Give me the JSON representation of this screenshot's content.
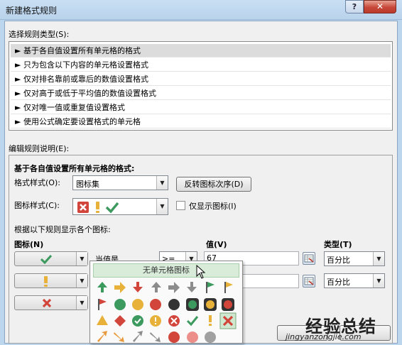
{
  "window": {
    "title": "新建格式规则",
    "help_label": "?",
    "close_label": "✕"
  },
  "rule_type": {
    "label": "选择规则类型(S):",
    "items": [
      "► 基于各自值设置所有单元格的格式",
      "► 只为包含以下内容的单元格设置格式",
      "► 仅对排名靠前或靠后的数值设置格式",
      "► 仅对高于或低于平均值的数值设置格式",
      "► 仅对唯一值或重复值设置格式",
      "► 使用公式确定要设置格式的单元格"
    ],
    "selected_index": 0
  },
  "edit": {
    "label": "编辑规则说明(E):",
    "heading": "基于各自值设置所有单元格的格式:",
    "format_style_label": "格式样式(O):",
    "format_style_value": "图标集",
    "reverse_button": "反转图标次序(D)",
    "icon_style_label": "图标样式(C):",
    "icon_style_icons": [
      "red-x-icon",
      "yellow-exclamation-icon",
      "green-check-icon"
    ],
    "show_icon_only_label": "仅显示图标(I)",
    "show_icon_only_checked": false,
    "rules_caption": "根据以下规则显示各个图标:",
    "col_icon": "图标(N)",
    "col_value": "值(V)",
    "col_type": "类型(T)",
    "rows": [
      {
        "icon": "green-check-icon",
        "cond_text": "当值是",
        "operator": ">=",
        "value": "67",
        "type": "百分比"
      },
      {
        "icon": "yellow-exclamation-icon",
        "value": "",
        "type": "百分比"
      },
      {
        "icon": "red-x-icon"
      }
    ]
  },
  "popup": {
    "no_icon_label": "无单元格图标"
  },
  "watermark": {
    "text": "经验总结",
    "url": "jingyanzongjie.com"
  },
  "colors": {
    "green": "#3c9a5f",
    "yellow": "#e8b23a",
    "red": "#d1453b",
    "gray": "#8c8c8c",
    "orange": "#e89a3c"
  }
}
